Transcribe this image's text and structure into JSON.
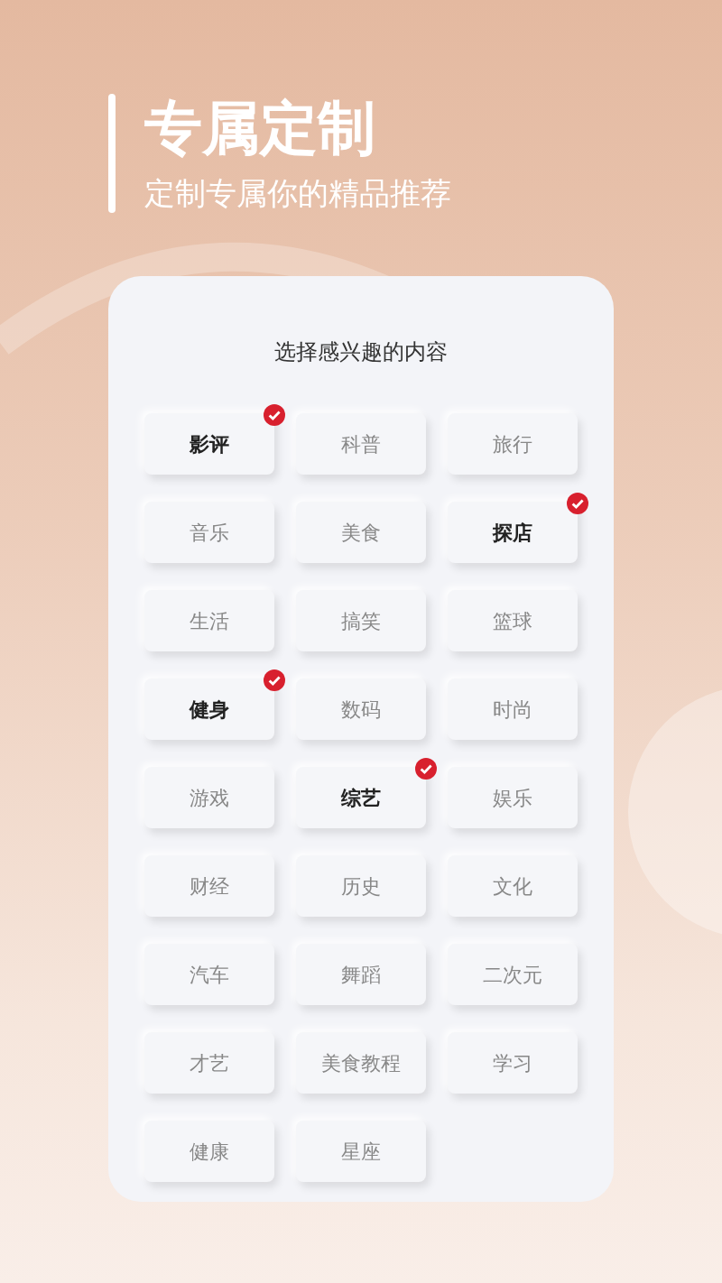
{
  "header": {
    "title": "专属定制",
    "subtitle": "定制专属你的精品推荐"
  },
  "card": {
    "title": "选择感兴趣的内容",
    "tags": [
      {
        "label": "影评",
        "selected": true
      },
      {
        "label": "科普",
        "selected": false
      },
      {
        "label": "旅行",
        "selected": false
      },
      {
        "label": "音乐",
        "selected": false
      },
      {
        "label": "美食",
        "selected": false
      },
      {
        "label": "探店",
        "selected": true
      },
      {
        "label": "生活",
        "selected": false
      },
      {
        "label": "搞笑",
        "selected": false
      },
      {
        "label": "篮球",
        "selected": false
      },
      {
        "label": "健身",
        "selected": true
      },
      {
        "label": "数码",
        "selected": false
      },
      {
        "label": "时尚",
        "selected": false
      },
      {
        "label": "游戏",
        "selected": false
      },
      {
        "label": "综艺",
        "selected": true
      },
      {
        "label": "娱乐",
        "selected": false
      },
      {
        "label": "财经",
        "selected": false
      },
      {
        "label": "历史",
        "selected": false
      },
      {
        "label": "文化",
        "selected": false
      },
      {
        "label": "汽车",
        "selected": false
      },
      {
        "label": "舞蹈",
        "selected": false
      },
      {
        "label": "二次元",
        "selected": false
      },
      {
        "label": "才艺",
        "selected": false
      },
      {
        "label": "美食教程",
        "selected": false
      },
      {
        "label": "学习",
        "selected": false
      },
      {
        "label": "健康",
        "selected": false
      },
      {
        "label": "星座",
        "selected": false
      }
    ]
  }
}
